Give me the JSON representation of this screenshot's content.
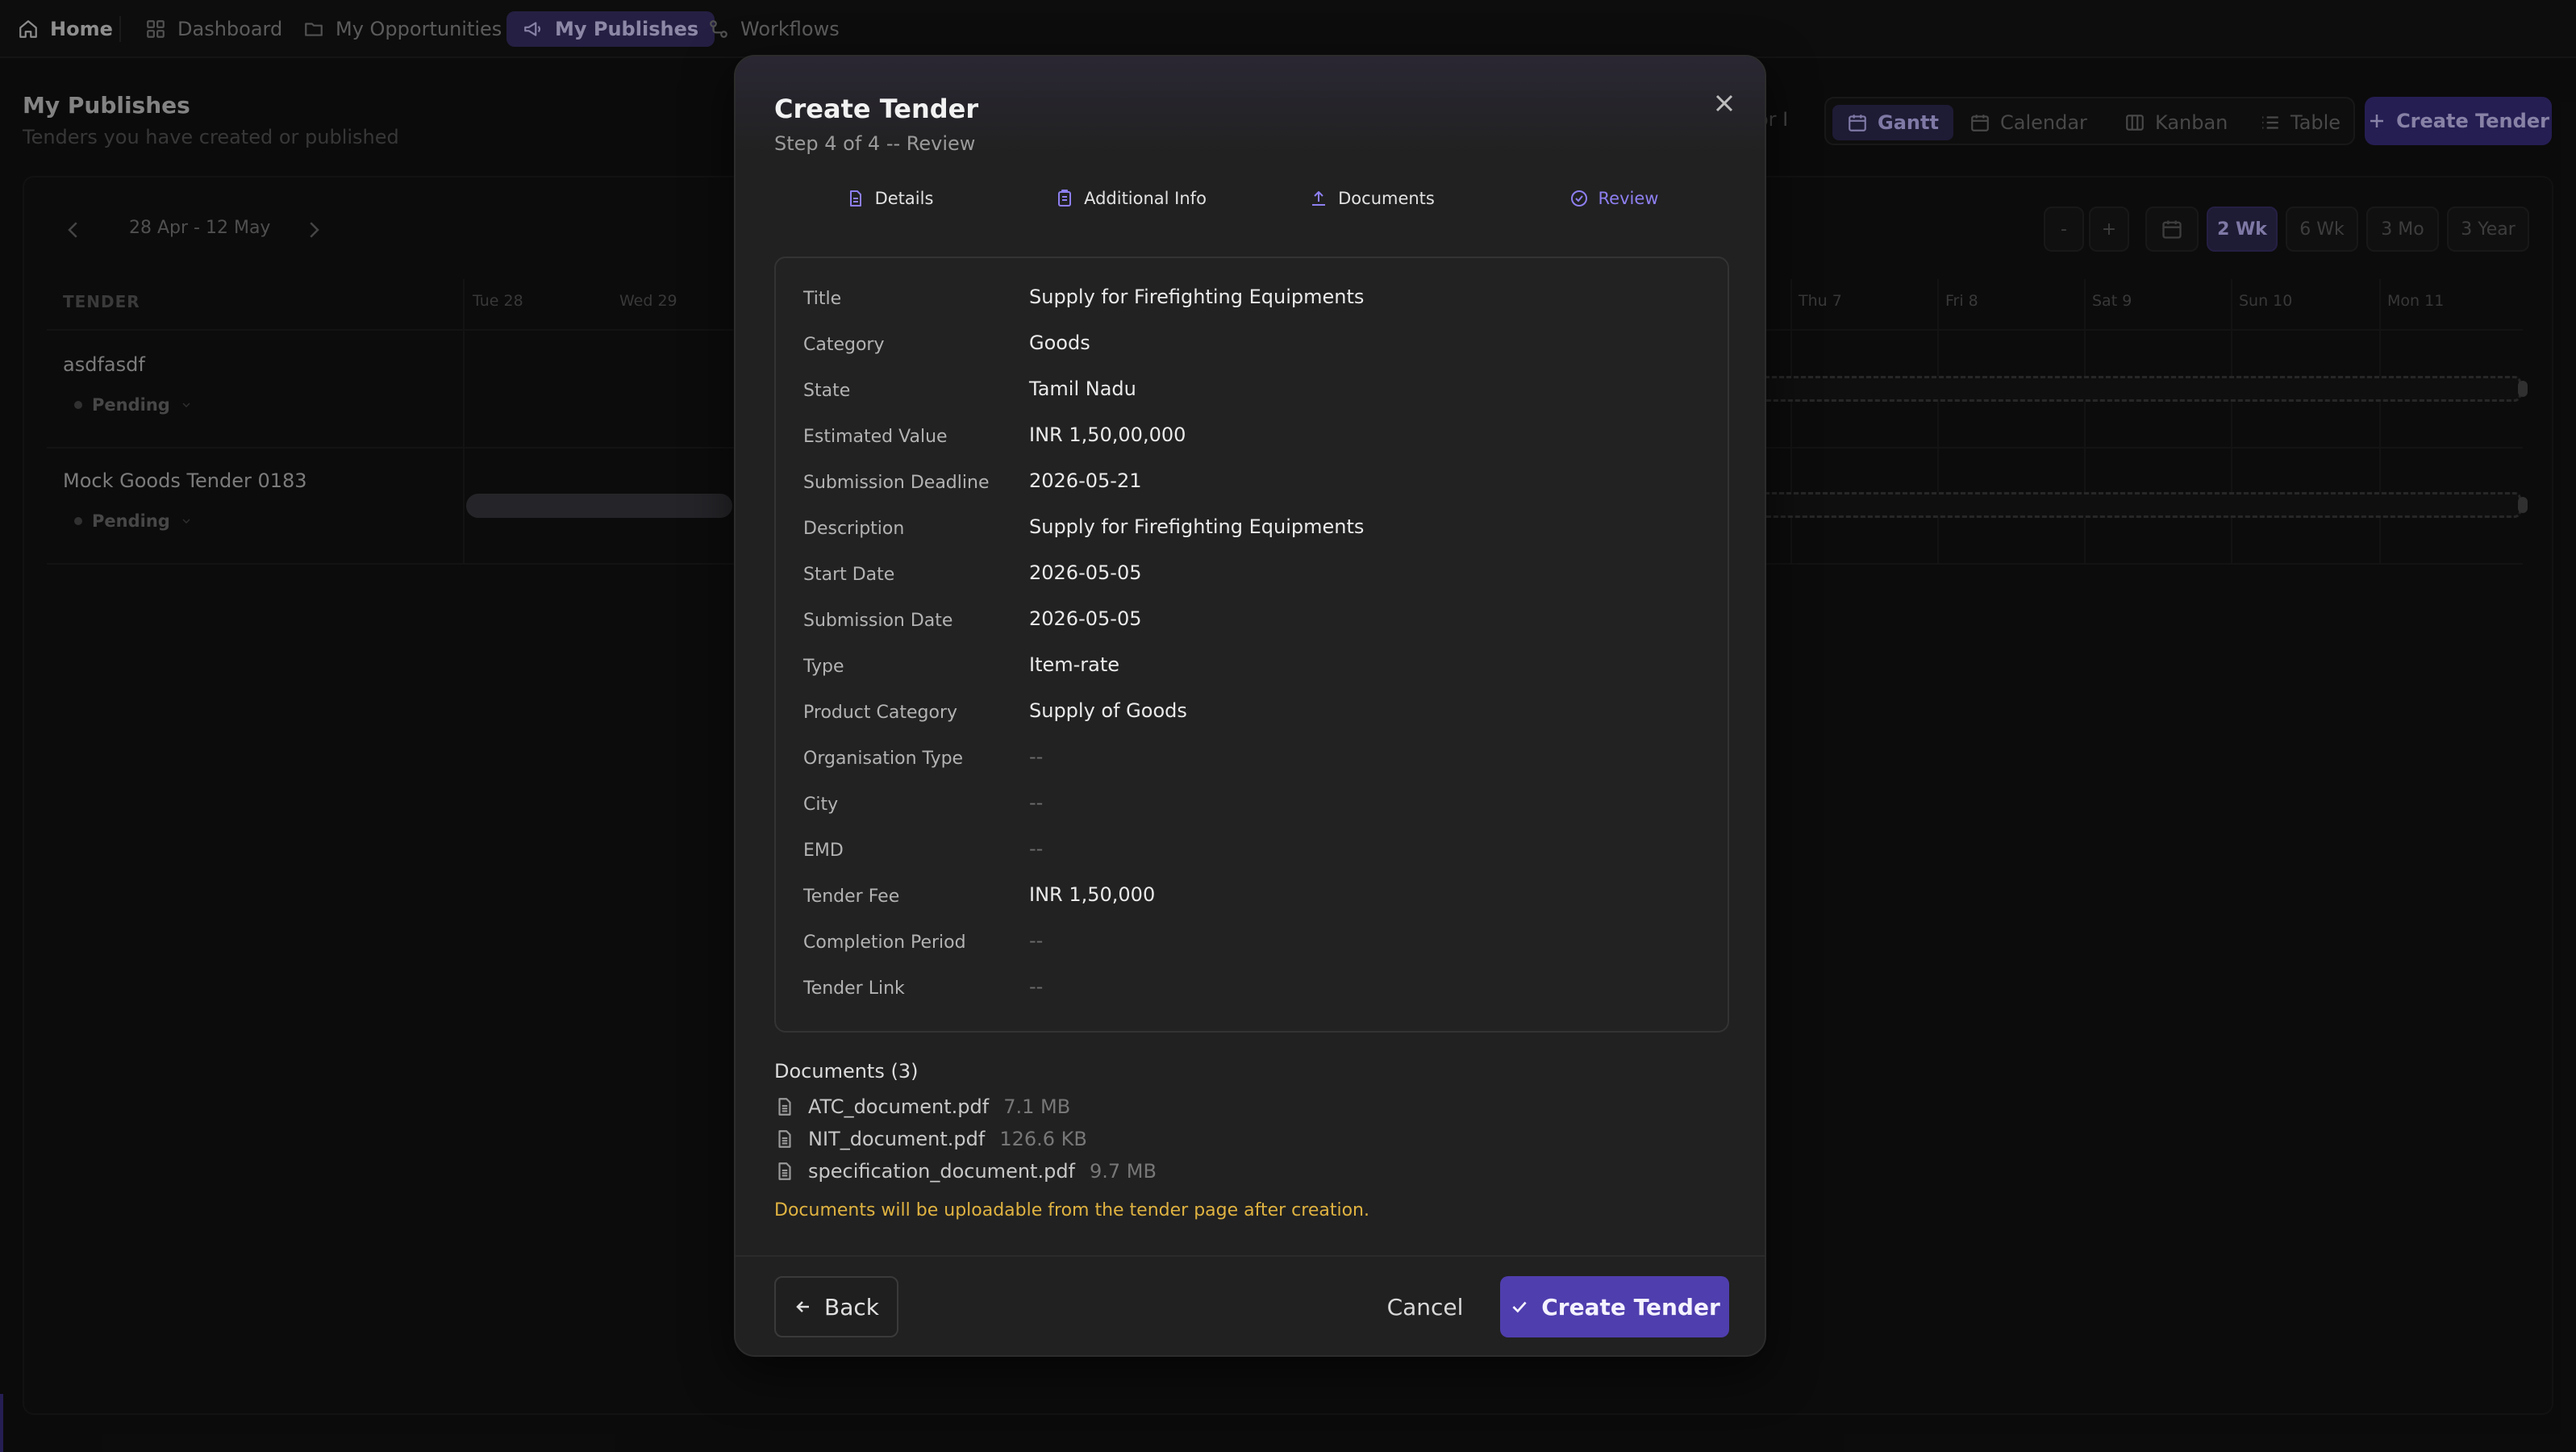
{
  "nav": {
    "items": [
      {
        "label": "Home",
        "icon": "home-icon"
      },
      {
        "label": "Dashboard",
        "icon": "grid-icon"
      },
      {
        "label": "My Opportunities",
        "icon": "folder-icon"
      },
      {
        "label": "My Publishes",
        "icon": "megaphone-icon"
      },
      {
        "label": "Workflows",
        "icon": "workflow-icon"
      }
    ],
    "active": "My Publishes"
  },
  "page": {
    "title": "My Publishes",
    "subtitle": "Tenders you have created or published"
  },
  "toolbar": {
    "partial_filter_text": "or I",
    "views": [
      {
        "label": "Gantt",
        "icon": "calendar-icon"
      },
      {
        "label": "Calendar",
        "icon": "calendar-icon"
      },
      {
        "label": "Kanban",
        "icon": "kanban-icon"
      },
      {
        "label": "Table",
        "icon": "list-icon"
      }
    ],
    "active_view": "Gantt",
    "create_label": "Create Tender"
  },
  "gantt": {
    "range_label": "28 Apr - 12 May",
    "zoom_buttons": [
      "-",
      "+"
    ],
    "ranges": [
      "2 Wk",
      "6 Wk",
      "3 Mo",
      "3 Year"
    ],
    "active_range": "2 Wk",
    "column_header": "TENDER",
    "days_left": [
      "Tue 28",
      "Wed 29"
    ],
    "days_right": [
      "Thu 7",
      "Fri 8",
      "Sat 9",
      "Sun 10",
      "Mon 11"
    ],
    "tasks": [
      {
        "name": "asdfasdf",
        "status": "Pending"
      },
      {
        "name": "Mock Goods Tender 0183",
        "status": "Pending"
      }
    ]
  },
  "modal": {
    "title": "Create Tender",
    "subtitle": "Step 4 of 4 -- Review",
    "steps": [
      {
        "label": "Details",
        "icon": "document-icon"
      },
      {
        "label": "Additional Info",
        "icon": "clipboard-icon"
      },
      {
        "label": "Documents",
        "icon": "upload-icon"
      },
      {
        "label": "Review",
        "icon": "check-circle-icon"
      }
    ],
    "current_step": "Review",
    "fields": [
      {
        "label": "Title",
        "value": "Supply for Firefighting Equipments"
      },
      {
        "label": "Category",
        "value": "Goods"
      },
      {
        "label": "State",
        "value": "Tamil Nadu"
      },
      {
        "label": "Estimated Value",
        "value": "INR 1,50,00,000"
      },
      {
        "label": "Submission Deadline",
        "value": "2026-05-21"
      },
      {
        "label": "Description",
        "value": "Supply for Firefighting Equipments"
      },
      {
        "label": "Start Date",
        "value": "2026-05-05"
      },
      {
        "label": "Submission Date",
        "value": "2026-05-05"
      },
      {
        "label": "Type",
        "value": "Item-rate"
      },
      {
        "label": "Product Category",
        "value": "Supply of Goods"
      },
      {
        "label": "Organisation Type",
        "value": "--"
      },
      {
        "label": "City",
        "value": "--"
      },
      {
        "label": "EMD",
        "value": "--"
      },
      {
        "label": "Tender Fee",
        "value": "INR 1,50,000"
      },
      {
        "label": "Completion Period",
        "value": "--"
      },
      {
        "label": "Tender Link",
        "value": "--"
      }
    ],
    "documents_title": "Documents (3)",
    "documents": [
      {
        "name": "ATC_document.pdf",
        "size": "7.1 MB"
      },
      {
        "name": "NIT_document.pdf",
        "size": "126.6 KB"
      },
      {
        "name": "specification_document.pdf",
        "size": "9.7 MB"
      }
    ],
    "documents_note": "Documents will be uploadable from the tender page after creation.",
    "back_label": "Back",
    "cancel_label": "Cancel",
    "create_label": "Create Tender"
  },
  "colors": {
    "accent": "#4f3eae",
    "accent_light": "#8d7ff0",
    "warning_text": "#e0b341",
    "background": "#121212",
    "modal_bg": "#212121"
  }
}
